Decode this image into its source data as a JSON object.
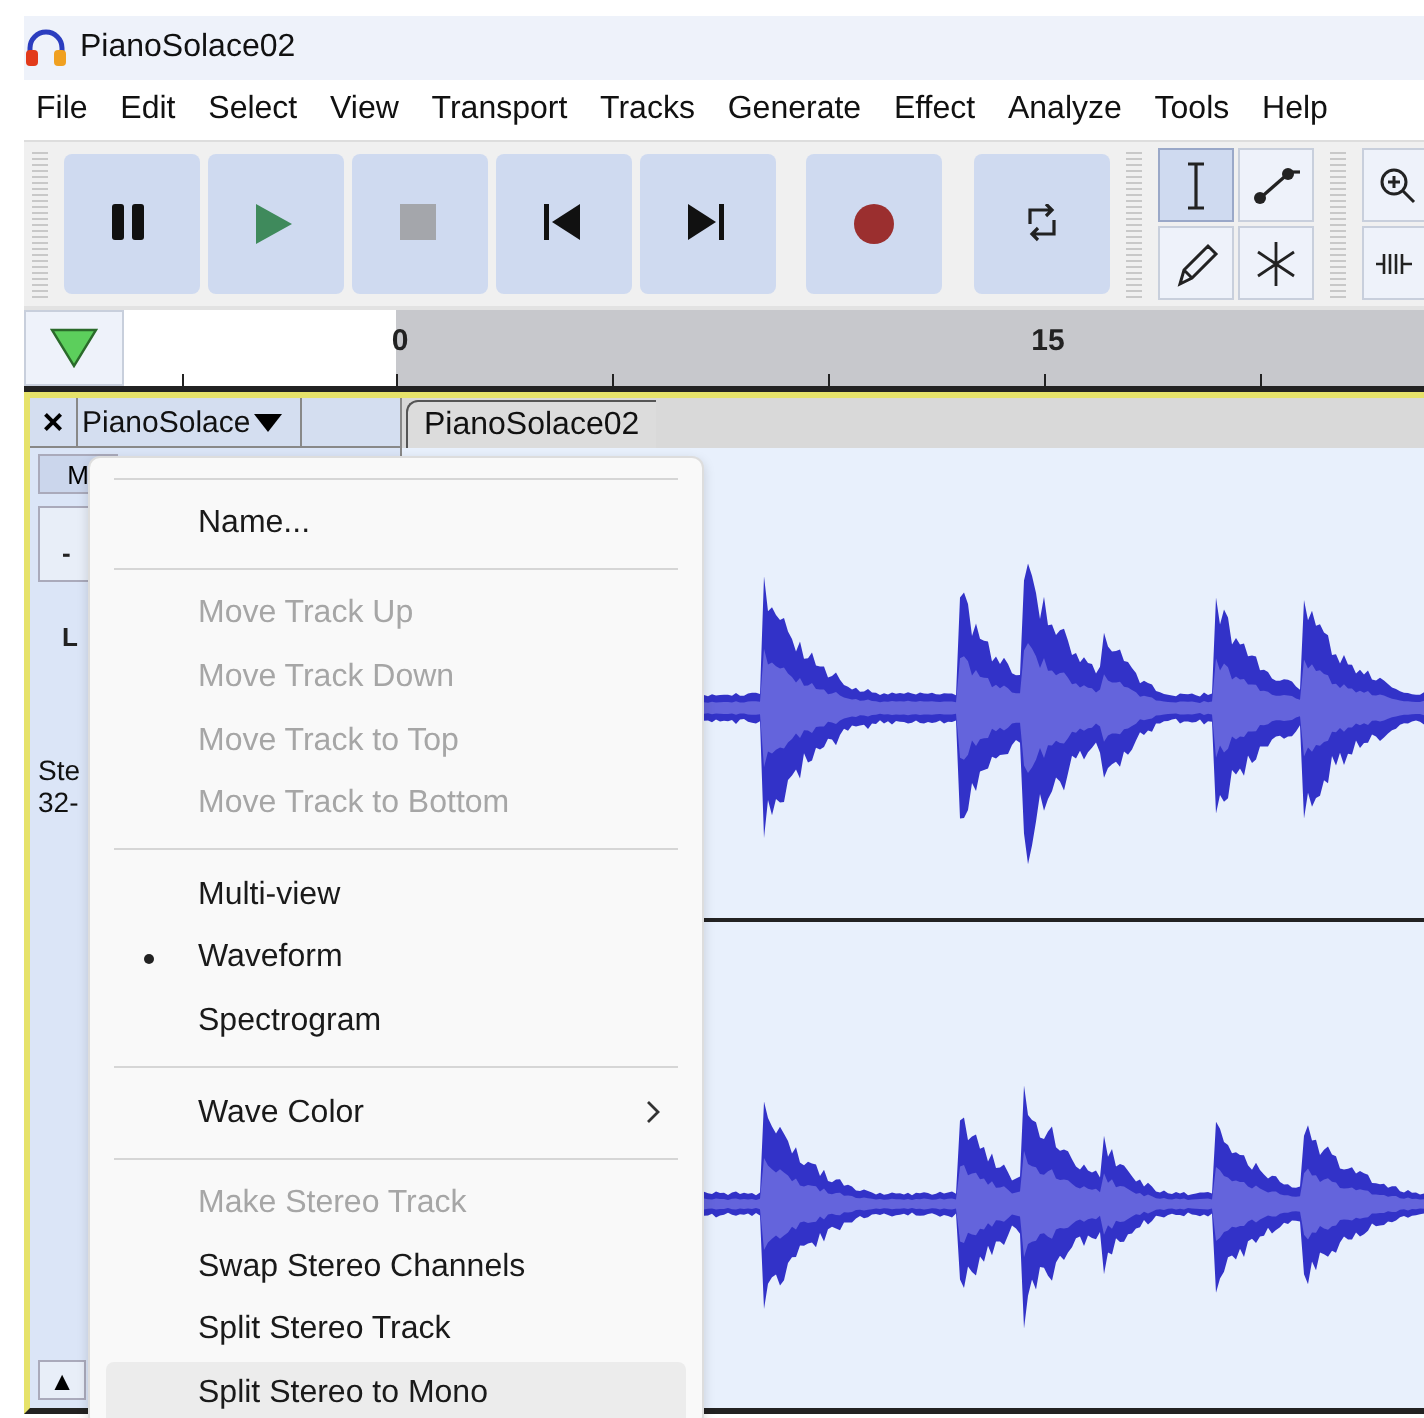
{
  "window": {
    "title": "PianoSolace02"
  },
  "menu_bar": [
    "File",
    "Edit",
    "Select",
    "View",
    "Transport",
    "Tracks",
    "Generate",
    "Effect",
    "Analyze",
    "Tools",
    "Help"
  ],
  "transport": [
    {
      "kind": "pause"
    },
    {
      "kind": "play"
    },
    {
      "kind": "stop"
    },
    {
      "kind": "skip-start"
    },
    {
      "kind": "skip-end"
    },
    {
      "kind": "record"
    },
    {
      "kind": "loop"
    }
  ],
  "tools": [
    {
      "kind": "select",
      "selected": true
    },
    {
      "kind": "envelope",
      "selected": false
    },
    {
      "kind": "draw",
      "selected": false
    },
    {
      "kind": "multi",
      "selected": false
    }
  ],
  "ruler": {
    "ticks": [
      {
        "label": "0"
      },
      {
        "label": "15"
      }
    ]
  },
  "track": {
    "close": "×",
    "name": "PianoSolace",
    "mute": "M",
    "gain": "-",
    "pan": "L",
    "info": [
      "Ste",
      "32-"
    ],
    "clip_title": "PianoSolace02",
    "collapse": "▲"
  },
  "context_menu": [
    {
      "kind": "separator"
    },
    {
      "kind": "item",
      "label": "Name...",
      "disabled": false,
      "checked": false,
      "submenu": false,
      "highlighted": false
    },
    {
      "kind": "separator"
    },
    {
      "kind": "item",
      "label": "Move Track Up",
      "disabled": true,
      "checked": false,
      "submenu": false,
      "highlighted": false
    },
    {
      "kind": "item",
      "label": "Move Track Down",
      "disabled": true,
      "checked": false,
      "submenu": false,
      "highlighted": false
    },
    {
      "kind": "item",
      "label": "Move Track to Top",
      "disabled": true,
      "checked": false,
      "submenu": false,
      "highlighted": false
    },
    {
      "kind": "item",
      "label": "Move Track to Bottom",
      "disabled": true,
      "checked": false,
      "submenu": false,
      "highlighted": false
    },
    {
      "kind": "separator"
    },
    {
      "kind": "item",
      "label": "Multi-view",
      "disabled": false,
      "checked": false,
      "submenu": false,
      "highlighted": false
    },
    {
      "kind": "item",
      "label": "Waveform",
      "disabled": false,
      "checked": true,
      "submenu": false,
      "highlighted": false
    },
    {
      "kind": "item",
      "label": "Spectrogram",
      "disabled": false,
      "checked": false,
      "submenu": false,
      "highlighted": false
    },
    {
      "kind": "separator"
    },
    {
      "kind": "item",
      "label": "Wave Color",
      "disabled": false,
      "checked": false,
      "submenu": true,
      "highlighted": false
    },
    {
      "kind": "separator"
    },
    {
      "kind": "item",
      "label": "Make Stereo Track",
      "disabled": true,
      "checked": false,
      "submenu": false,
      "highlighted": false
    },
    {
      "kind": "item",
      "label": "Swap Stereo Channels",
      "disabled": false,
      "checked": false,
      "submenu": false,
      "highlighted": false
    },
    {
      "kind": "item",
      "label": "Split Stereo Track",
      "disabled": false,
      "checked": false,
      "submenu": false,
      "highlighted": false
    },
    {
      "kind": "item",
      "label": "Split Stereo to Mono",
      "disabled": false,
      "checked": false,
      "submenu": false,
      "highlighted": true
    }
  ]
}
